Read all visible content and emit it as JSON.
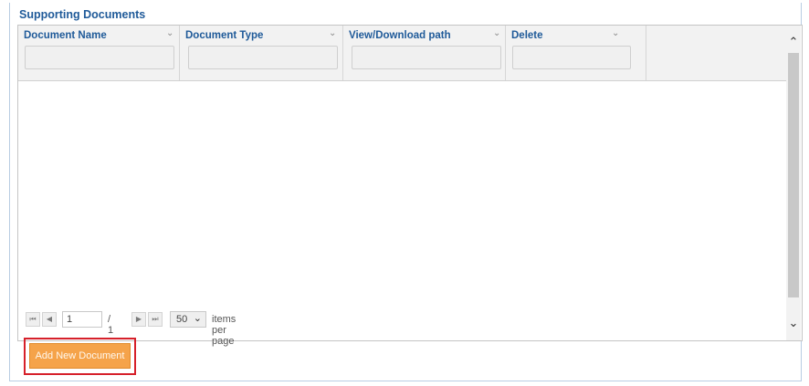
{
  "panel": {
    "title": "Supporting Documents"
  },
  "grid": {
    "columns": [
      {
        "label": "Document Name"
      },
      {
        "label": "Document Type"
      },
      {
        "label": "View/Download path"
      },
      {
        "label": "Delete"
      }
    ],
    "column_menu_icon": "chevron-down-icon",
    "rows": []
  },
  "pager": {
    "current_page": "1",
    "total_pages": "/ 1",
    "per_page_value": "50",
    "per_page_label": "items per page",
    "first_icon": "first-page-icon",
    "prev_icon": "prev-page-icon",
    "next_icon": "next-page-icon",
    "last_icon": "last-page-icon"
  },
  "actions": {
    "add_document_label": "Add New Document"
  },
  "colors": {
    "title_blue": "#1f5a99",
    "button_orange": "#f5a34a",
    "highlight_red": "#d6202a"
  }
}
